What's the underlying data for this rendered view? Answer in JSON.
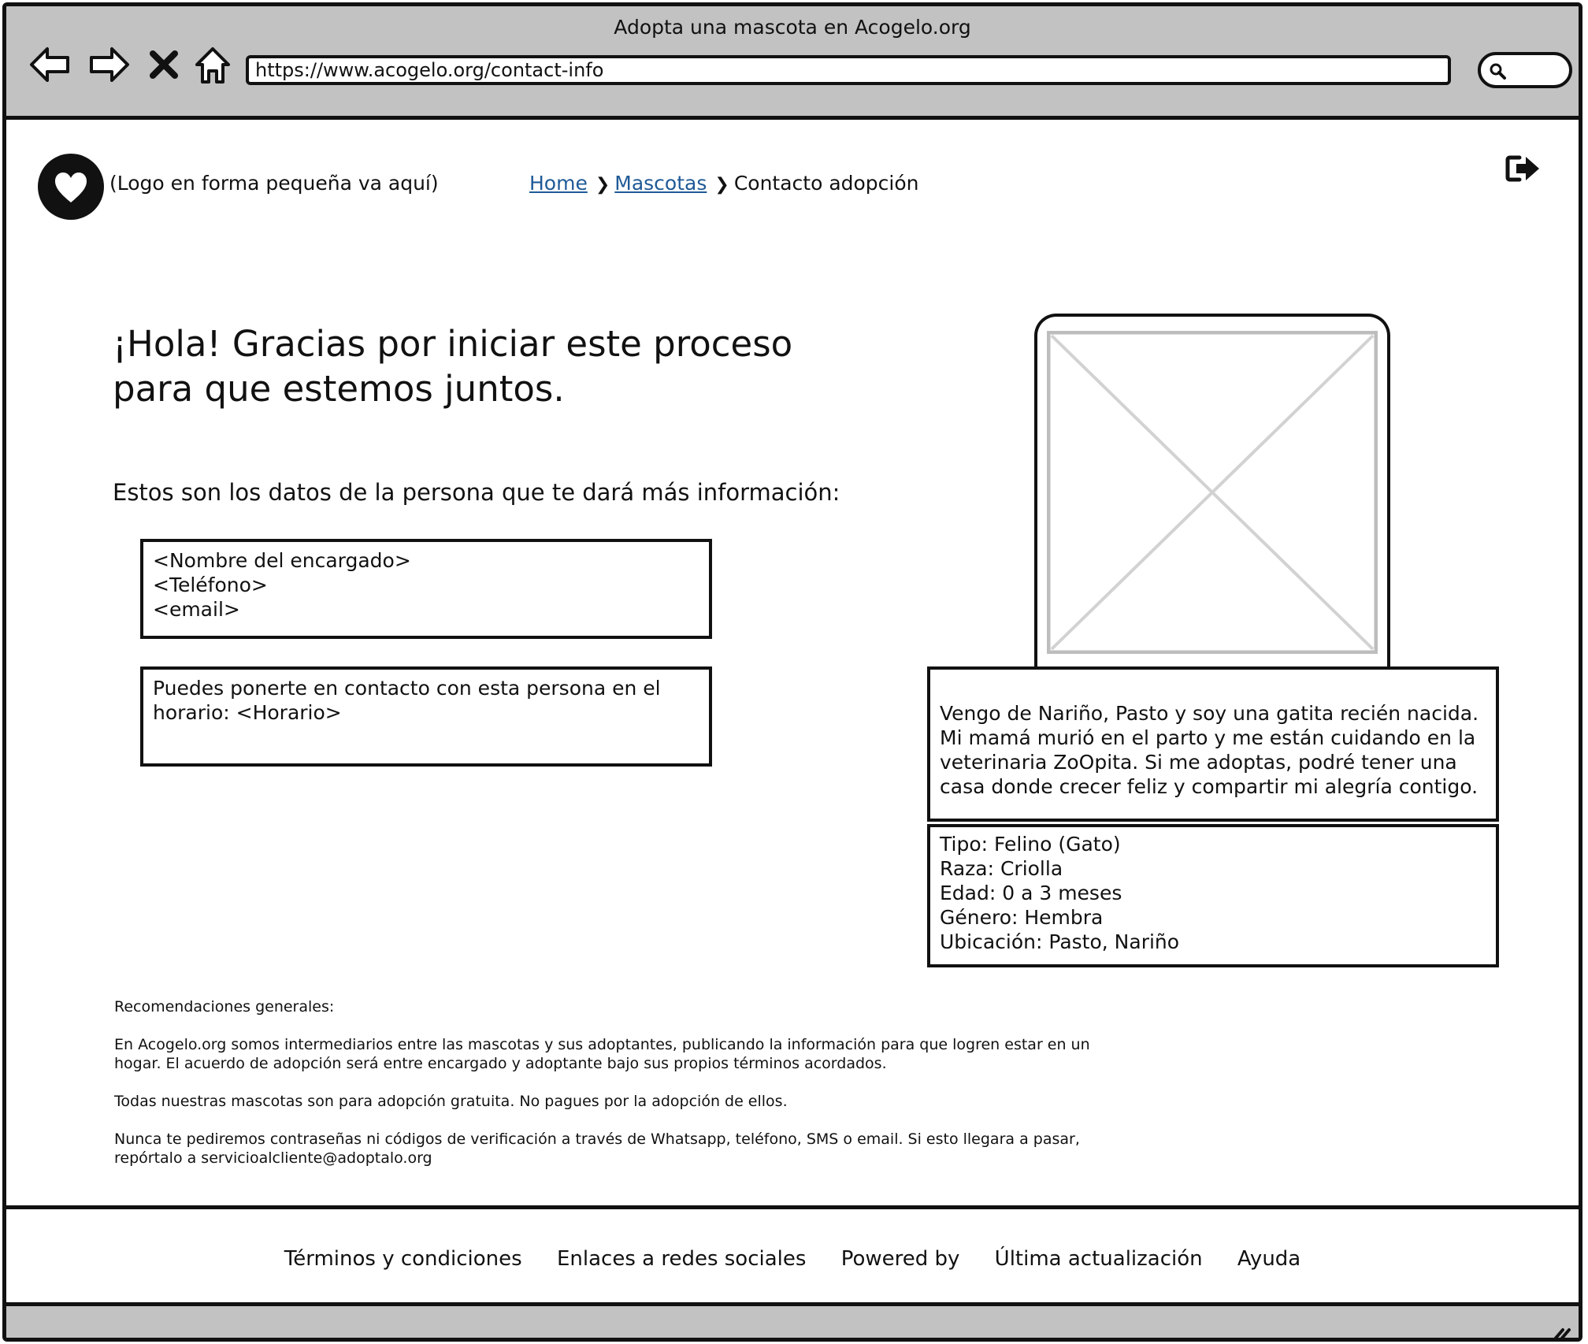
{
  "browser": {
    "title": "Adopta una mascota en Acogelo.org",
    "url": "https://www.acogelo.org/contact-info"
  },
  "header": {
    "logo_text": "(Logo en forma pequeña va aquí)",
    "breadcrumb": {
      "home": "Home",
      "pets": "Mascotas",
      "current": "Contacto adopción"
    }
  },
  "main": {
    "heading": "¡Hola! Gracias por iniciar este proceso para que estemos juntos.",
    "subheading": "Estos son los datos de la persona que te dará más información:",
    "contact": {
      "name": "<Nombre del encargado>",
      "phone": "<Teléfono>",
      "email": "<email>"
    },
    "schedule_text": "Puedes ponerte en contacto con esta persona en el horario: <Horario>"
  },
  "pet": {
    "description": "Vengo de Nariño, Pasto y soy una gatita recién nacida. Mi mamá murió en el parto y me están cuidando en la veterinaria ZoOpita. Si me adoptas, podré tener una casa donde crecer feliz y compartir mi alegría contigo.",
    "type": "Tipo: Felino (Gato)",
    "breed": "Raza: Criolla",
    "age": "Edad: 0 a 3 meses",
    "gender": "Género: Hembra",
    "location": "Ubicación: Pasto, Nariño"
  },
  "recommendations": {
    "title": "Recomendaciones generales:",
    "p1": "En Acogelo.org somos intermediarios entre las mascotas y sus adoptantes, publicando la información para que logren estar en un hogar. El acuerdo de adopción será entre encargado y adoptante bajo sus propios términos acordados.",
    "p2": "Todas nuestras mascotas son para adopción gratuita. No pagues por la adopción de ellos.",
    "p3": "Nunca te pediremos contraseñas ni códigos de verificación a través de Whatsapp, teléfono, SMS o email. Si esto llegara a pasar, repórtalo a servicioalcliente@adoptalo.org"
  },
  "footer": {
    "terms": "Términos y condiciones",
    "social": "Enlaces a redes sociales",
    "powered": "Powered by",
    "updated": "Última actualización",
    "help": "Ayuda"
  },
  "icons": {
    "back": "back-arrow-icon",
    "forward": "forward-arrow-icon",
    "close": "close-icon",
    "home": "home-icon",
    "search": "search-icon",
    "logo": "heart-icon",
    "logout": "logout-icon",
    "image": "image-placeholder-icon",
    "resize": "resize-grip-icon"
  }
}
